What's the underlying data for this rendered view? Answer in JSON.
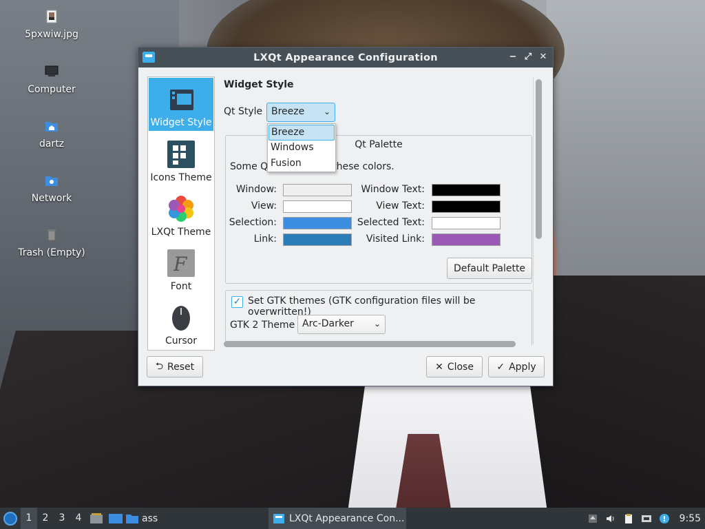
{
  "desktop": {
    "icons": [
      {
        "label": "5pxwiw.jpg",
        "icon": "image-file-icon"
      },
      {
        "label": "Computer",
        "icon": "computer-icon"
      },
      {
        "label": "dartz",
        "icon": "home-folder-icon"
      },
      {
        "label": "Network",
        "icon": "network-folder-icon"
      },
      {
        "label": "Trash (Empty)",
        "icon": "trash-icon"
      }
    ]
  },
  "window": {
    "title": "LXQt Appearance Configuration",
    "controls": {
      "minimize": "−",
      "maximize": "⤢",
      "close": "✕"
    },
    "sidebar": [
      {
        "label": "Widget Style",
        "icon": "widget-style-icon",
        "active": true
      },
      {
        "label": "Icons Theme",
        "icon": "icons-theme-icon",
        "active": false
      },
      {
        "label": "LXQt Theme",
        "icon": "lxqt-theme-icon",
        "active": false
      },
      {
        "label": "Font",
        "icon": "font-icon",
        "active": false
      },
      {
        "label": "Cursor",
        "icon": "cursor-icon",
        "active": false
      }
    ],
    "widget_style": {
      "heading": "Widget Style",
      "qt_style_label": "Qt Style",
      "qt_style_value": "Breeze",
      "qt_style_options": [
        "Breeze",
        "Windows",
        "Fusion"
      ],
      "palette_title": "Qt Palette",
      "palette_desc_left": "Some Q",
      "palette_desc_right": "nore these colors.",
      "palette": {
        "window_label": "Window:",
        "window_color": "#efefef",
        "window_text_label": "Window Text:",
        "window_text_color": "#000000",
        "view_label": "View:",
        "view_color": "#ffffff",
        "view_text_label": "View Text:",
        "view_text_color": "#000000",
        "selection_label": "Selection:",
        "selection_color": "#3d8ee0",
        "selected_text_label": "Selected Text:",
        "selected_text_color": "#ffffff",
        "link_label": "Link:",
        "link_color": "#2a7db8",
        "visited_link_label": "Visited Link:",
        "visited_link_color": "#9b59b6"
      },
      "default_palette_button": "Default Palette",
      "gtk_checkbox_label": "Set GTK themes (GTK configuration files will be overwritten!)",
      "gtk_checked": true,
      "gtk2_label": "GTK 2 Theme",
      "gtk2_value": "Arc-Darker"
    },
    "buttons": {
      "reset": "Reset",
      "close": "Close",
      "apply": "Apply"
    }
  },
  "taskbar": {
    "workspaces": [
      "1",
      "2",
      "3",
      "4"
    ],
    "active_workspace": "1",
    "quicklaunch_folder_label": "ass",
    "task_label": "LXQt Appearance Con...",
    "clock": "9:55"
  },
  "colors": {
    "accent": "#3daee9",
    "titlebar": "#475057",
    "taskbar": "#30353a"
  }
}
